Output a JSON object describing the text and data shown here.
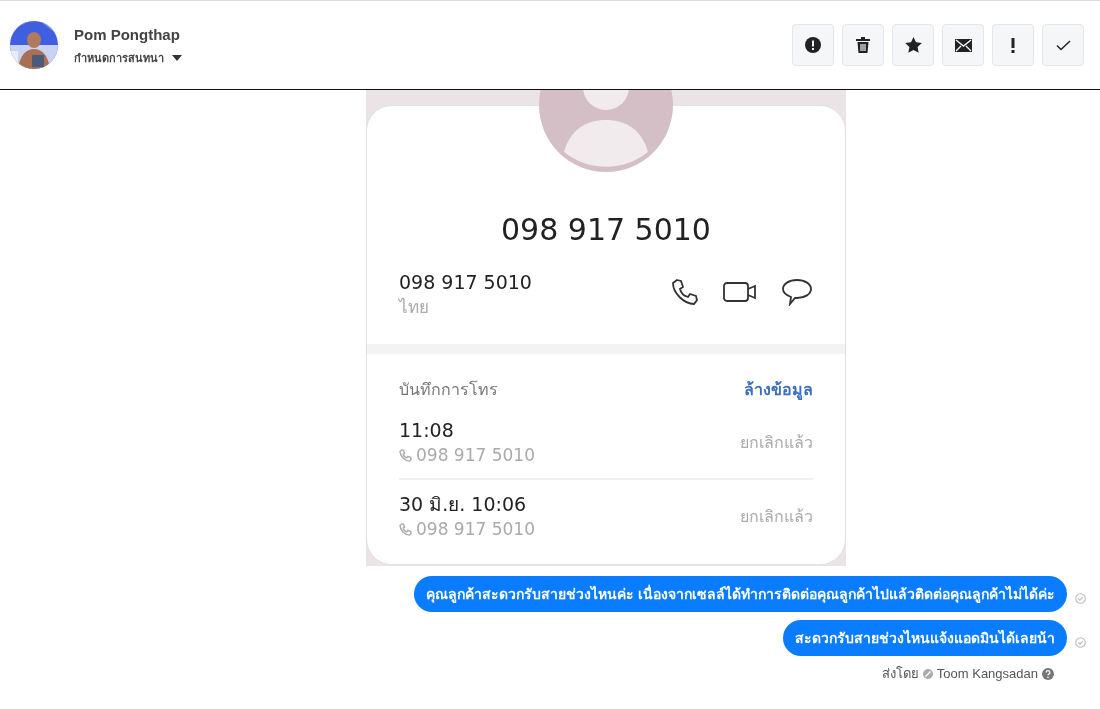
{
  "header": {
    "contact_name": "Pom Pongthap",
    "subtitle": "กำหนดการสนทนา"
  },
  "toolbar": [
    {
      "kind": "spam"
    },
    {
      "kind": "delete"
    },
    {
      "kind": "star"
    },
    {
      "kind": "mail"
    },
    {
      "kind": "important"
    },
    {
      "kind": "done"
    }
  ],
  "attachment": {
    "kind": "screenshot",
    "title_number": "098 917 5010",
    "number": "098 917 5010",
    "region": "ไทย",
    "log_title": "บันทึกการโทร",
    "clear_link": "ล้างข้อมูล",
    "calls": [
      {
        "time": "11:08",
        "number": "098 917 5010",
        "status": "ยกเลิกแล้ว"
      },
      {
        "time": "30 มิ.ย. 10:06",
        "number": "098 917 5010",
        "status": "ยกเลิกแล้ว"
      }
    ]
  },
  "messages": [
    {
      "text": "คุณลูกค้าสะดวกรับสายช่วงไหนค่ะ  เนื่องจากเซลล์ได้ทำการติดต่อคุณลูกค้าไปแล้วติดต่อคุณลูกค้าไม่ได้ค่ะ",
      "delivered": true
    },
    {
      "text": "สะดวกรับสายช่วงไหนแจ้งแอดมินได้เลยน้า",
      "delivered": true
    }
  ],
  "sent_by": {
    "label": "ส่งโดย",
    "name": "Toom Kangsadan"
  }
}
